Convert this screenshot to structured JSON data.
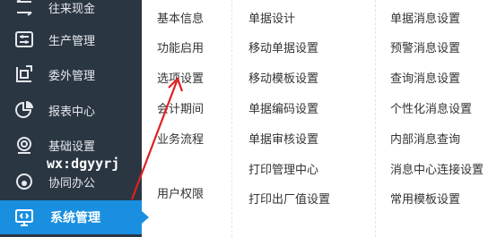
{
  "sidebar": {
    "items": [
      {
        "label": "往来现金",
        "icon": "cash-icon"
      },
      {
        "label": "生产管理",
        "icon": "production-icon"
      },
      {
        "label": "委外管理",
        "icon": "outsourcing-icon"
      },
      {
        "label": "报表中心",
        "icon": "report-icon"
      },
      {
        "label": "基础设置",
        "icon": "settings-icon"
      },
      {
        "label": "协同办公",
        "icon": "collaboration-icon"
      },
      {
        "label": "系统管理",
        "icon": "system-icon",
        "active": true
      }
    ],
    "watermark": "wx:dgyyrj"
  },
  "menu": {
    "col1": [
      "基本信息",
      "功能启用",
      "选项设置",
      "会计期间",
      "业务流程",
      "用户权限"
    ],
    "col2": [
      "单据设计",
      "移动单据设置",
      "移动模板设置",
      "单据编码设置",
      "单据审核设置",
      "打印管理中心",
      "打印出厂值设置"
    ],
    "col3": [
      "单据消息设置",
      "预警消息设置",
      "查询消息设置",
      "个性化消息设置",
      "内部消息查询",
      "消息中心连接设置",
      "常用模板设置"
    ]
  },
  "colors": {
    "sidebar_bg": "#2b3643",
    "active_bg": "#1a8fe0",
    "annotation_arrow": "#e02020"
  }
}
